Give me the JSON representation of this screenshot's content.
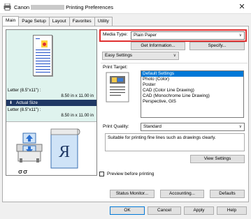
{
  "window": {
    "title_prefix": "Canon",
    "title_suffix": "Printing Preferences",
    "close_glyph": "✕"
  },
  "tabs": [
    "Main",
    "Page Setup",
    "Layout",
    "Favorites",
    "Utility"
  ],
  "preview": {
    "paper_top_line1": "Letter (8.5\"x11\") :",
    "paper_top_line2": "8.50 in x 11.00 in",
    "actual_size": "Actual Size",
    "paper_bottom_line1": "Letter (8.5\"x11\") :",
    "paper_bottom_line2": "8.50 in x 11.00 in"
  },
  "media_type": {
    "label": "Media Type:",
    "value": "Plain Paper"
  },
  "buttons": {
    "get_information": "Get Information...",
    "specify": "Specify...",
    "view_settings": "View Settings",
    "status_monitor": "Status Monitor...",
    "accounting": "Accounting...",
    "defaults": "Defaults",
    "ok": "OK",
    "cancel": "Cancel",
    "apply": "Apply",
    "help": "Help"
  },
  "settings_mode": {
    "value": "Easy Settings"
  },
  "print_target": {
    "label": "Print Target:",
    "items": [
      "Default Settings",
      "Photo (Color)",
      "Poster",
      "CAD (Color Line Drawing)",
      "CAD (Monochrome Line Drawing)",
      "Perspective, GIS"
    ],
    "selected_index": 0
  },
  "print_quality": {
    "label": "Print Quality:",
    "value": "Standard"
  },
  "description": "Suitable for printing fine lines such as drawings clearly.",
  "preview_before_printing": {
    "label": "Preview before printing",
    "checked": false
  },
  "colors": {
    "highlight": "#e03030",
    "selection": "#0078d7",
    "actual_bar": "#1f3864"
  }
}
